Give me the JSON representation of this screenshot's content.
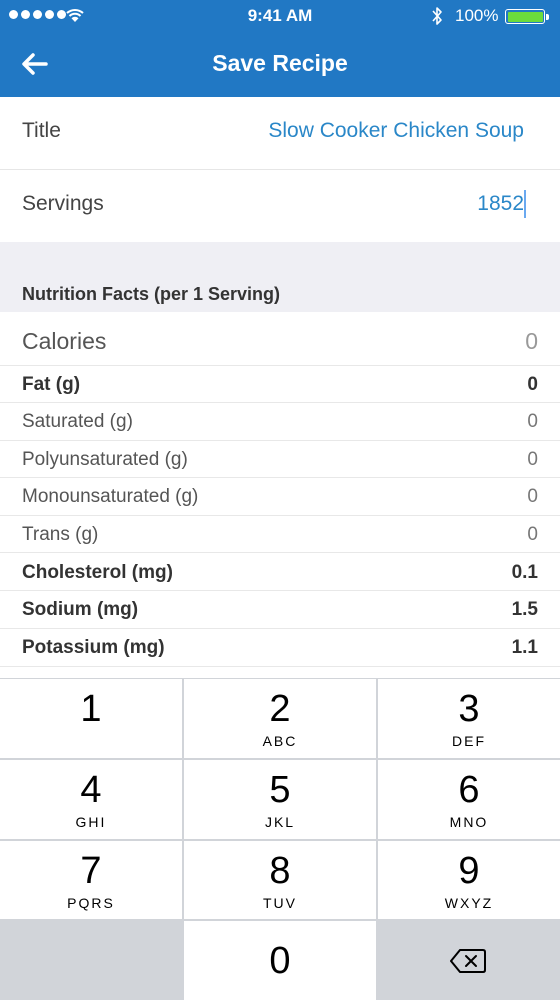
{
  "status_bar": {
    "time": "9:41 AM",
    "battery": "100%"
  },
  "nav": {
    "title": "Save Recipe"
  },
  "form": {
    "title_label": "Title",
    "title_value": "Slow Cooker Chicken Soup",
    "servings_label": "Servings",
    "servings_value": "1852"
  },
  "nutrition": {
    "header": "Nutrition Facts (per 1 Serving)",
    "rows": [
      {
        "label": "Calories",
        "value": "0"
      },
      {
        "label": "Fat (g)",
        "value": "0"
      },
      {
        "label": "Saturated (g)",
        "value": "0"
      },
      {
        "label": "Polyunsaturated (g)",
        "value": "0"
      },
      {
        "label": "Monounsaturated (g)",
        "value": "0"
      },
      {
        "label": "Trans (g)",
        "value": "0"
      },
      {
        "label": "Cholesterol (mg)",
        "value": "0.1"
      },
      {
        "label": "Sodium (mg)",
        "value": "1.5"
      },
      {
        "label": "Potassium (mg)",
        "value": "1.1"
      }
    ]
  },
  "keypad": {
    "keys": [
      {
        "digit": "1",
        "letters": ""
      },
      {
        "digit": "2",
        "letters": "ABC"
      },
      {
        "digit": "3",
        "letters": "DEF"
      },
      {
        "digit": "4",
        "letters": "GHI"
      },
      {
        "digit": "5",
        "letters": "JKL"
      },
      {
        "digit": "6",
        "letters": "MNO"
      },
      {
        "digit": "7",
        "letters": "PQRS"
      },
      {
        "digit": "8",
        "letters": "TUV"
      },
      {
        "digit": "9",
        "letters": "WXYZ"
      },
      {
        "digit": "0",
        "letters": ""
      }
    ],
    "delete_icon": "backspace-icon"
  },
  "colors": {
    "nav_bg": "#2178c4",
    "accent_text": "#2a87c8",
    "keypad_bg": "#d1d4d9"
  }
}
